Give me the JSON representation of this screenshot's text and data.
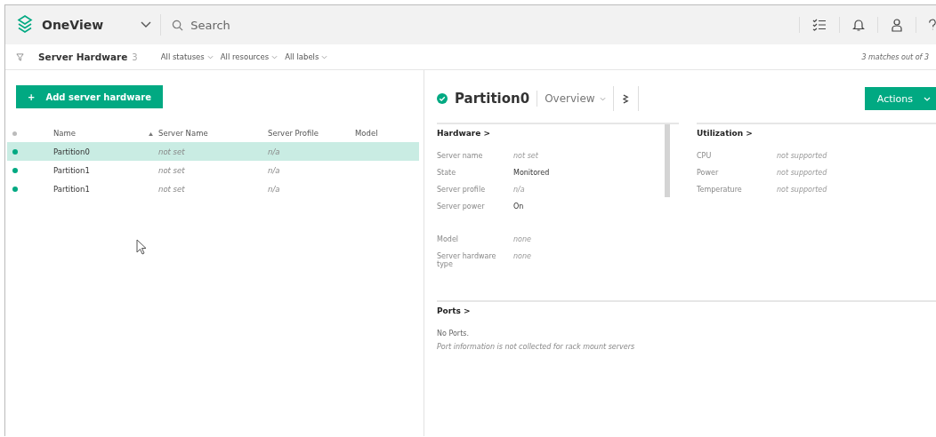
{
  "app": {
    "title": "OneView",
    "search_placeholder": "Search"
  },
  "filter_bar": {
    "title": "Server Hardware",
    "count": "3",
    "filters": [
      "All statuses",
      "All resources",
      "All labels"
    ],
    "matches": "3 matches out of 3"
  },
  "add_button": {
    "label": "Add server hardware",
    "icon": "+"
  },
  "table": {
    "columns": [
      {
        "label": "Name",
        "sorted": true
      },
      {
        "label": "Server Name",
        "sorted": false
      },
      {
        "label": "Server Profile",
        "sorted": false
      },
      {
        "label": "Model",
        "sorted": false
      }
    ],
    "rows": [
      {
        "name": "Partition0",
        "server_name": "not set",
        "server_profile": "n/a",
        "selected": true
      },
      {
        "name": "Partition1",
        "server_name": "not set",
        "server_profile": "n/a",
        "selected": false
      },
      {
        "name": "Partition1",
        "server_name": "not set",
        "server_profile": "n/a",
        "selected": false
      }
    ]
  },
  "detail": {
    "title": "Partition0",
    "view": "Overview",
    "actions": "Actions",
    "hardware": {
      "heading": "Hardware >",
      "groups": [
        [
          {
            "label": "Server name",
            "value": "not set",
            "muted": true
          },
          {
            "label": "State",
            "value": "Monitored",
            "muted": false
          },
          {
            "label": "Server profile",
            "value": "n/a",
            "muted": true
          },
          {
            "label": "Server power",
            "value": "On",
            "muted": false
          }
        ],
        [
          {
            "label": "Model",
            "value": "none",
            "muted": true
          },
          {
            "label": "Server hardware type",
            "value": "none",
            "muted": true
          }
        ]
      ]
    },
    "utilization": {
      "heading": "Utilization >",
      "items": [
        {
          "label": "CPU",
          "value": "not supported",
          "muted": true
        },
        {
          "label": "Power",
          "value": "not supported",
          "muted": true
        },
        {
          "label": "Temperature",
          "value": "not supported",
          "muted": true
        }
      ]
    },
    "ports": {
      "heading": "Ports >",
      "message": "No Ports.",
      "note": "Port information is not collected for rack mount servers"
    }
  }
}
